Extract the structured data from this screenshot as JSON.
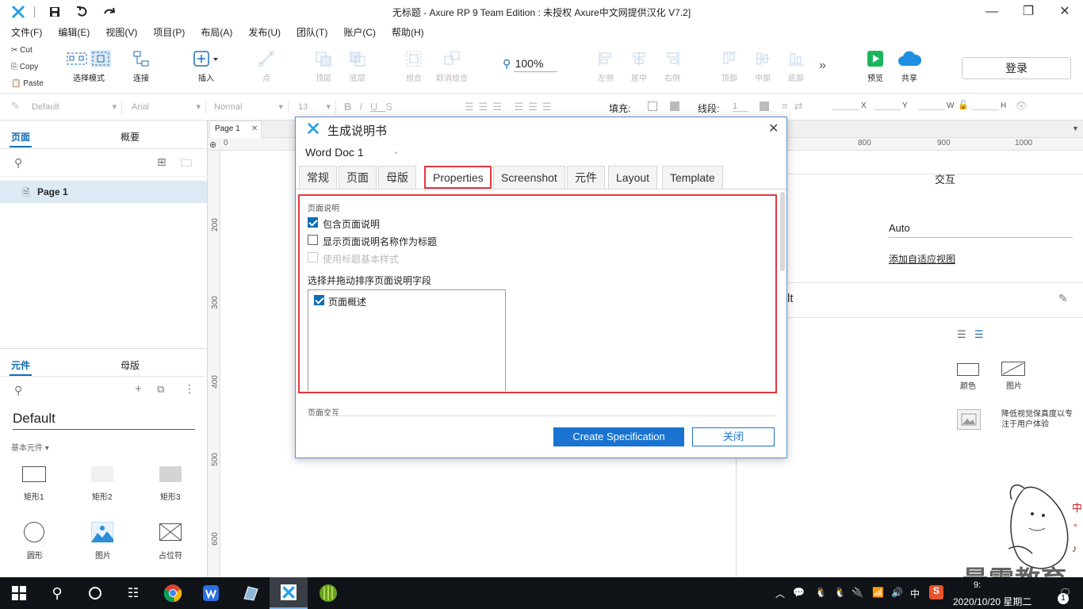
{
  "window": {
    "title": "无标题 - Axure RP 9 Team Edition : 未授权    Axure中文网提供汉化 V7.2]"
  },
  "menu": [
    "文件(F)",
    "编辑(E)",
    "视图(V)",
    "项目(P)",
    "布局(A)",
    "发布(U)",
    "团队(T)",
    "账户(C)",
    "帮助(H)"
  ],
  "clipboard": {
    "cut": "Cut",
    "copy": "Copy",
    "paste": "Paste"
  },
  "toolbar": {
    "select_mode": "选择模式",
    "connect": "连接",
    "insert": "插入",
    "point": "点",
    "top_layer": "顶层",
    "bottom_layer": "底层",
    "group": "组合",
    "ungroup": "取消组合",
    "zoom": "100%",
    "align_left": "左侧",
    "align_center": "居中",
    "align_right": "右侧",
    "align_top": "顶部",
    "align_middle": "中部",
    "align_bottom": "底部",
    "preview": "预览",
    "share": "共享",
    "login": "登录"
  },
  "stylebar": {
    "style": "Default",
    "font": "Arial",
    "weight": "Normal",
    "size": "13",
    "fill_label": "填充:",
    "line_label": "线段:",
    "line_value": "1",
    "x": "X",
    "y": "Y",
    "w": "W",
    "h": "H"
  },
  "pages_panel": {
    "tab_pages": "页面",
    "tab_outline": "概要",
    "page_item": "Page 1"
  },
  "widgets_panel": {
    "tab_widgets": "元件",
    "tab_masters": "母版",
    "library": "Default",
    "group": "基本元件 ▾",
    "items": [
      "矩形1",
      "矩形2",
      "矩形3",
      "圆形",
      "图片",
      "占位符"
    ]
  },
  "canvas": {
    "tab": "Page 1",
    "ruler_h": [
      "0",
      "800",
      "900",
      "1000"
    ],
    "ruler_v": [
      "200",
      "300",
      "400",
      "500",
      "600"
    ]
  },
  "right_panel": {
    "interactions": "交互",
    "adaptive_value": "Auto",
    "add_adaptive": "添加自适应视图",
    "partial_title": "lt",
    "color_label": "颜色",
    "image_label": "图片",
    "low_fidelity": "降低视觉保真度以专注于用户体验"
  },
  "dialog": {
    "title": "生成说明书",
    "doc": "Word Doc 1",
    "tabs": [
      "常规",
      "页面",
      "母版",
      "Properties",
      "Screenshot",
      "元件",
      "Layout",
      "Template"
    ],
    "active_tab": "Properties",
    "section_title": "页面说明",
    "option_include": "包含页面说明",
    "option_show_name": "显示页面说明名称作为标题",
    "option_heading_style": "使用标题基本样式",
    "fields_label": "选择并拖动排序页面说明字段",
    "field_item": "页面概述",
    "section_interactions": "页面交互",
    "create_button": "Create Specification",
    "close_button": "关闭",
    "highlight_color": "#e0393e"
  },
  "taskbar": {
    "ime": "中",
    "time": "9:",
    "date": "2020/10/20 星期二",
    "notification_count": "1"
  },
  "watermark": {
    "text": "最需教育",
    "side_chars": [
      "中",
      "°",
      "♪"
    ]
  }
}
